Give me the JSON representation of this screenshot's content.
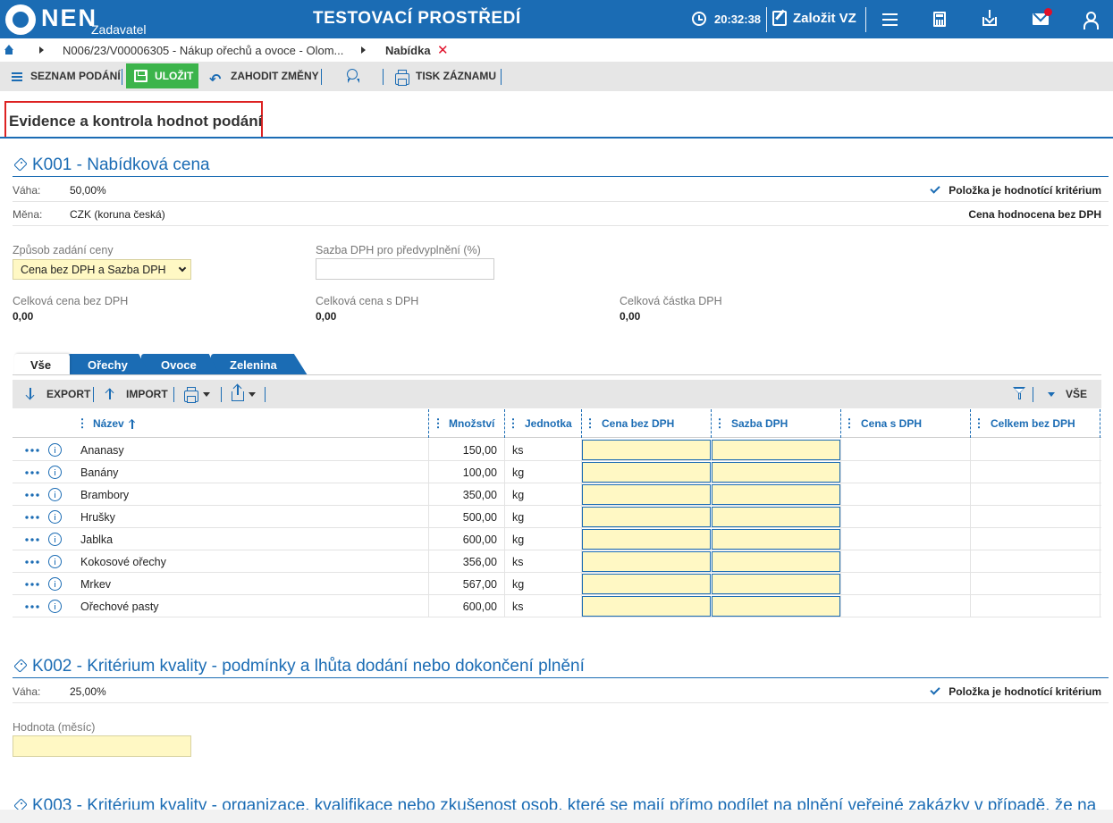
{
  "header": {
    "logo_text": "NEN",
    "logo_sub": "Zadavatel",
    "environment_title": "TESTOVACÍ PROSTŘEDÍ",
    "clock": "20:32:38",
    "create_label": "Založit VZ",
    "accent_color": "#1b6cb4"
  },
  "breadcrumb": {
    "items": [
      "N006/23/V00006305 - Nákup ořechů a ovoce - Olom...",
      "Nabídka"
    ]
  },
  "toolbar": {
    "list_label": "SEZNAM PODÁNÍ",
    "save_label": "ULOŽIT",
    "discard_label": "ZAHODIT ZMĚNY",
    "print_label": "TISK ZÁZNAMU"
  },
  "page": {
    "title": "Evidence a kontrola hodnot podání"
  },
  "k001": {
    "title": "K001 - Nabídková cena",
    "weight_label": "Váha:",
    "weight_value": "50,00%",
    "currency_label": "Měna:",
    "currency_value": "CZK (koruna česká)",
    "criterion_note": "Položka je hodnotící kritérium",
    "evaluation_note": "Cena hodnocena bez DPH",
    "price_mode_label": "Způsob zadání ceny",
    "price_mode_value": "Cena bez DPH a Sazba DPH",
    "vat_prefill_label": "Sazba DPH pro předvyplnění (%)",
    "vat_prefill_value": "",
    "total_wo_vat_label": "Celková cena bez DPH",
    "total_wo_vat_value": "0,00",
    "total_w_vat_label": "Celková cena s DPH",
    "total_w_vat_value": "0,00",
    "total_vat_label": "Celková částka DPH",
    "total_vat_value": "0,00"
  },
  "tabs": [
    {
      "label": "Vše",
      "active": true
    },
    {
      "label": "Ořechy",
      "active": false
    },
    {
      "label": "Ovoce",
      "active": false
    },
    {
      "label": "Zelenina",
      "active": false
    }
  ],
  "grid_toolbar": {
    "export_label": "EXPORT",
    "import_label": "IMPORT",
    "all_label": "VŠE"
  },
  "columns": [
    "Název",
    "Množství",
    "Jednotka",
    "Cena bez DPH",
    "Sazba DPH",
    "Cena s DPH",
    "Celkem bez DPH"
  ],
  "rows": [
    {
      "name": "Ananasy",
      "qty": "150,00",
      "unit": "ks"
    },
    {
      "name": "Banány",
      "qty": "100,00",
      "unit": "kg"
    },
    {
      "name": "Brambory",
      "qty": "350,00",
      "unit": "kg"
    },
    {
      "name": "Hrušky",
      "qty": "500,00",
      "unit": "kg"
    },
    {
      "name": "Jablka",
      "qty": "600,00",
      "unit": "kg"
    },
    {
      "name": "Kokosové ořechy",
      "qty": "356,00",
      "unit": "ks"
    },
    {
      "name": "Mrkev",
      "qty": "567,00",
      "unit": "kg"
    },
    {
      "name": "Ořechové pasty",
      "qty": "600,00",
      "unit": "ks"
    }
  ],
  "k002": {
    "title": "K002 - Kritérium kvality - podmínky a lhůta dodání nebo dokončení plnění",
    "weight_label": "Váha:",
    "weight_value": "25,00%",
    "criterion_note": "Položka je hodnotící kritérium",
    "value_label": "Hodnota (měsíc)",
    "value": ""
  },
  "k003": {
    "title": "K003 - Kritérium kvality - organizace, kvalifikace nebo zkušenost osob, které se mají přímo podílet na plnění veřejné zakázky v případě, že na"
  }
}
